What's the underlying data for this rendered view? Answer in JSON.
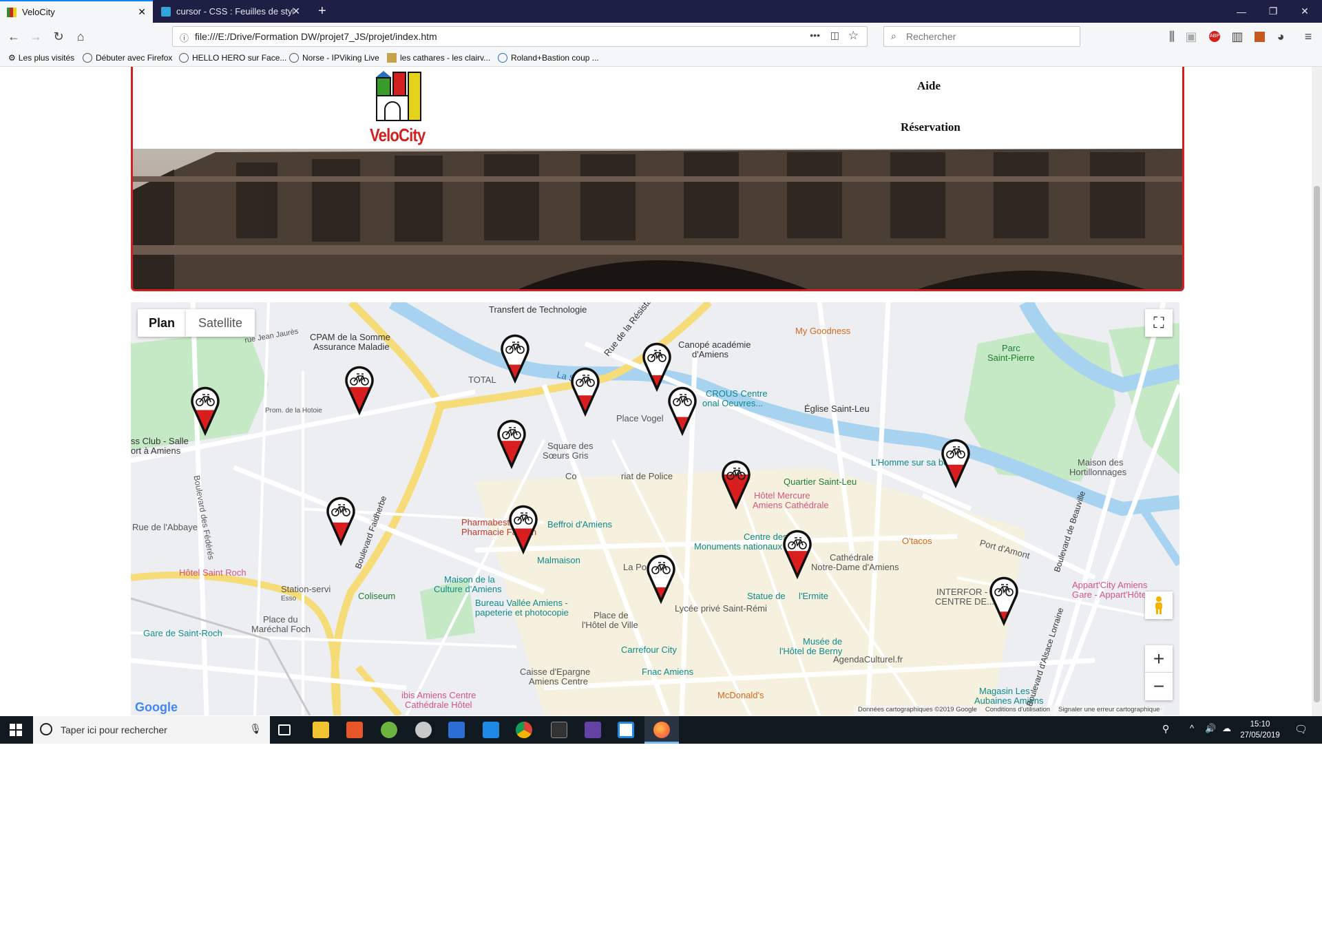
{
  "browser": {
    "tabs": [
      {
        "title": "VeloCity",
        "active": true
      },
      {
        "title": "cursor - CSS : Feuilles de style e",
        "active": false
      }
    ],
    "new_tab": "+",
    "url": "file:///E:/Drive/Formation DW/projet7_JS/projet/index.htm",
    "search_placeholder": "Rechercher",
    "bookmarks": [
      "Les plus visités",
      "Débuter avec Firefox",
      "HELLO HERO sur Face...",
      "Norse - IPViking Live",
      "les cathares - les clairv...",
      "Roland+Bastion coup ..."
    ]
  },
  "site": {
    "logo_text": "VeloCity",
    "nav": [
      "Aide",
      "Réservation"
    ]
  },
  "map": {
    "type_buttons": [
      "Plan",
      "Satellite"
    ],
    "zoom_in": "+",
    "zoom_out": "−",
    "google_logo": "Google",
    "footer": [
      "Données cartographiques ©2019 Google",
      "Conditions d'utilisation",
      "Signaler une erreur cartographique"
    ],
    "labels": [
      "Transfert de Technologie",
      "CPAM de la Somme",
      "Assurance Maladie",
      "rue Jean Jaurès",
      "My Goodness",
      "Canopé académie",
      "d'Amiens",
      "Parc",
      "Saint-Pierre",
      "TOTAL",
      "La Somme",
      "Rue de la Résistance",
      "CROUS Centre",
      "onal Oeuvres...",
      "Église Saint-Leu",
      "Prom. de la Hotoie",
      "ss Club - Salle",
      "ort à Amiens",
      "Place Vogel",
      "Square des",
      "Sœurs Gris",
      "Co",
      "riat de Police",
      "Quartier Saint-Leu",
      "L'Homme sur sa bouée",
      "Maison des",
      "Hortillonnages",
      "Hôtel Mercure",
      "Amiens Cathédrale",
      "Pharmabest",
      "Pharmacie Fachon",
      "Beffroi d'Amiens",
      "Centre des",
      "Monuments nationaux",
      "O'tacos",
      "Port d'Amont",
      "Rue de l'Abbaye",
      "Boulevard des Fédérés",
      "Boulevard Faidherbe",
      "Malmaison",
      "Cathédrale",
      "Notre-Dame d'Amiens",
      "Hôtel Saint Roch",
      "Station-servi",
      "Esso",
      "Coliseum",
      "Maison de la",
      "Culture d'Amiens",
      "La Poste",
      "Statue de",
      "l'Ermite",
      "INTERFOR -",
      "CENTRE DE...",
      "Appart'City Amiens",
      "Gare - Appart'Hôtel",
      "Bureau Vallée Amiens -",
      "papeterie et photocopie",
      "Lycée privé Saint-Rémi",
      "Place de",
      "l'Hôtel de Ville",
      "Place du",
      "Maréchal Foch",
      "Gare de Saint-Roch",
      "Carrefour City",
      "Musée de",
      "l'Hôtel de Berny",
      "AgendaCulturel.fr",
      "Fnac Amiens",
      "Caisse d'Epargne",
      "Amiens Centre",
      "McDonald's",
      "ibis Amiens Centre",
      "Cathédrale Hôtel",
      "Magasin Les",
      "Aubaines Amiens",
      "Boulevard de Beauville",
      "Boulevard d'Alsace Lorraine"
    ],
    "station_markers": [
      {
        "fill": 0.5
      },
      {
        "fill": 0.55
      },
      {
        "fill": 0.35
      },
      {
        "fill": 0.4
      },
      {
        "fill": 0.3
      },
      {
        "fill": 0.35
      },
      {
        "fill": 0.55
      },
      {
        "fill": 0.45
      },
      {
        "fill": 0.7
      },
      {
        "fill": 0.45
      },
      {
        "fill": 0.5
      },
      {
        "fill": 0.55
      },
      {
        "fill": 0.3
      },
      {
        "fill": 0.25
      }
    ]
  },
  "taskbar": {
    "search_placeholder": "Taper ici pour rechercher",
    "time": "15:10",
    "date": "27/05/2019"
  },
  "colors": {
    "brand_red": "#d21f1f",
    "tab_strip": "#1d2044",
    "marker_red": "#d81e1e"
  }
}
